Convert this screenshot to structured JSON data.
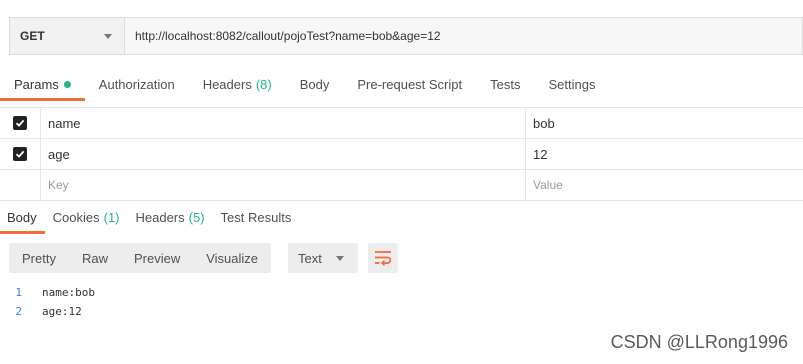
{
  "request": {
    "method": "GET",
    "url": "http://localhost:8082/callout/pojoTest?name=bob&age=12"
  },
  "request_tabs": [
    {
      "label": "Params",
      "count": null,
      "active": true,
      "dot": true
    },
    {
      "label": "Authorization",
      "count": null
    },
    {
      "label": "Headers",
      "count": "(8)"
    },
    {
      "label": "Body",
      "count": null
    },
    {
      "label": "Pre-request Script",
      "count": null
    },
    {
      "label": "Tests",
      "count": null
    },
    {
      "label": "Settings",
      "count": null
    }
  ],
  "params": {
    "rows": [
      {
        "checked": true,
        "key": "name",
        "value": "bob"
      },
      {
        "checked": true,
        "key": "age",
        "value": "12"
      }
    ],
    "key_placeholder": "Key",
    "value_placeholder": "Value"
  },
  "response_tabs": [
    {
      "label": "Body",
      "count": null,
      "active": true
    },
    {
      "label": "Cookies",
      "count": "(1)"
    },
    {
      "label": "Headers",
      "count": "(5)"
    },
    {
      "label": "Test Results",
      "count": null
    }
  ],
  "view_modes": [
    "Pretty",
    "Raw",
    "Preview",
    "Visualize"
  ],
  "format_select": "Text",
  "body_lines": [
    {
      "num": "1",
      "text": "name:bob"
    },
    {
      "num": "2",
      "text": "age:12"
    }
  ],
  "watermark": "CSDN @LLRong1996",
  "colors": {
    "accent": "#f26b3a",
    "count_green": "#26b47f",
    "line_number_blue": "#3a7bd5"
  },
  "icons": {
    "wrap": "wrap-lines-icon",
    "dropdown": "chevron-down-icon",
    "checkbox": "checkbox-checked-icon"
  }
}
